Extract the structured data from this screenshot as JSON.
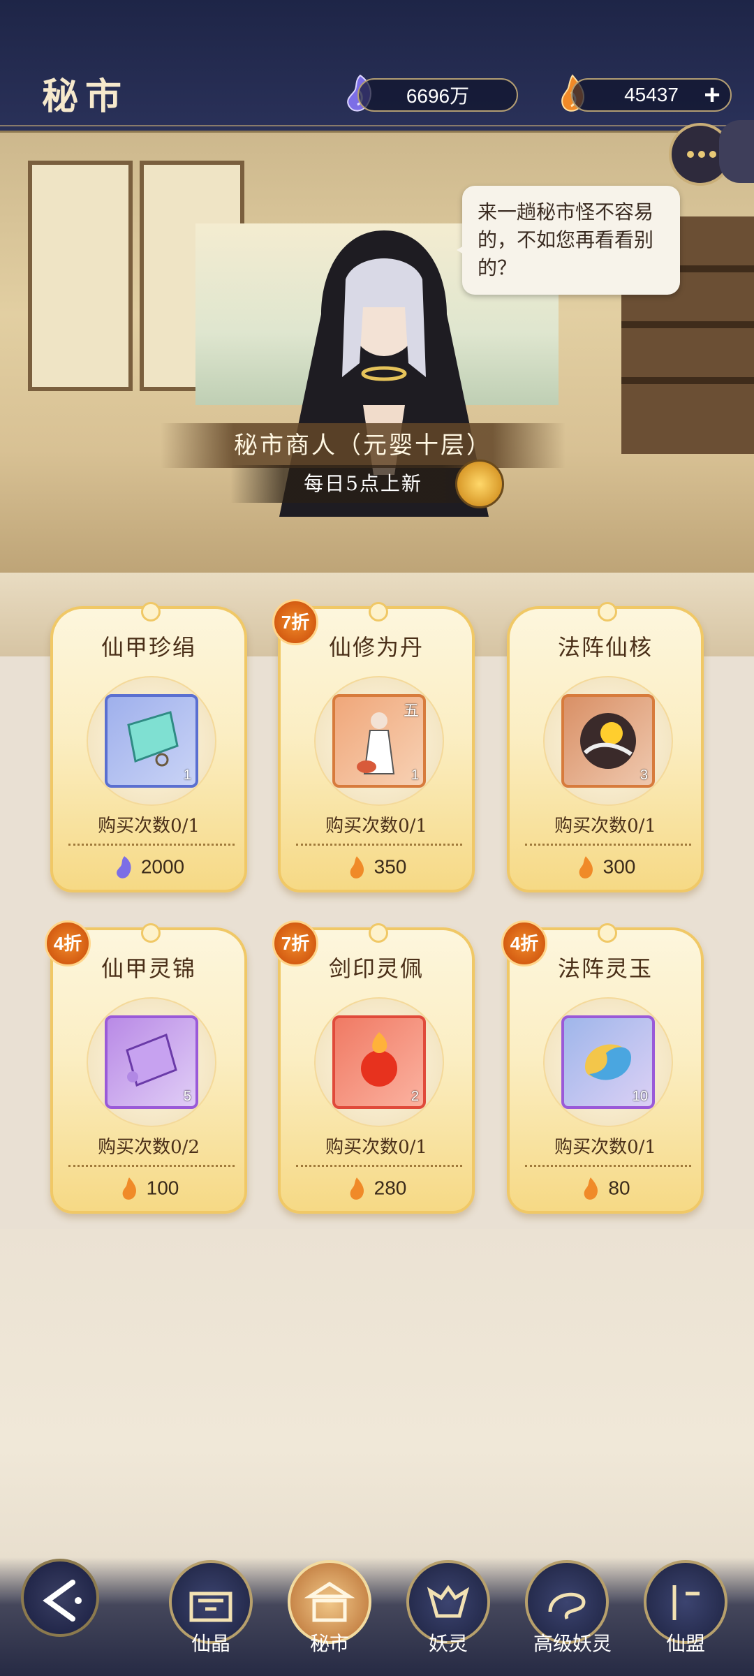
{
  "header": {
    "title": "秘市",
    "currency_1": "6696万",
    "currency_2": "45437",
    "add_label": "+"
  },
  "scene": {
    "dialogue": "来一趟秘市怪不容易的，不如您再看看别的？",
    "merchant_name": "秘市商人（元婴十层）",
    "refresh_note": "每日5点上新"
  },
  "items": [
    {
      "name": "仙甲珍绢",
      "count": "1",
      "limit": "购买次数0/1",
      "price": "2000",
      "currency": "blue",
      "discount": ""
    },
    {
      "name": "仙修为丹",
      "count": "1",
      "grade": "五",
      "limit": "购买次数0/1",
      "price": "350",
      "currency": "orange",
      "discount": "7折"
    },
    {
      "name": "法阵仙核",
      "count": "3",
      "limit": "购买次数0/1",
      "price": "300",
      "currency": "orange",
      "discount": ""
    },
    {
      "name": "仙甲灵锦",
      "count": "5",
      "limit": "购买次数0/2",
      "price": "100",
      "currency": "orange",
      "discount": "4折"
    },
    {
      "name": "剑印灵佩",
      "count": "2",
      "limit": "购买次数0/1",
      "price": "280",
      "currency": "orange",
      "discount": "7折"
    },
    {
      "name": "法阵灵玉",
      "count": "10",
      "limit": "购买次数0/1",
      "price": "80",
      "currency": "orange",
      "discount": "4折"
    }
  ],
  "nav": {
    "items": [
      "仙晶",
      "秘市",
      "妖灵",
      "高级妖灵",
      "仙盟"
    ],
    "active": "秘市"
  },
  "colors": {
    "header_bg": "#1e2547",
    "card_border": "#f0c866",
    "discount": "#d45c12"
  }
}
